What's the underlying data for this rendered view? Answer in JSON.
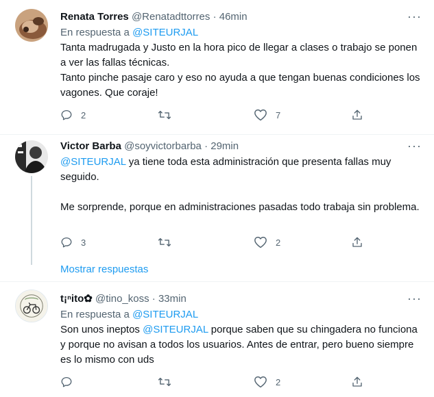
{
  "colors": {
    "accent": "#1d9bf0",
    "text": "#0f1419",
    "muted": "#536471",
    "divider": "#eff3f4"
  },
  "tweets": [
    {
      "name": "Renata Torres",
      "handle": "@Renatadttorres",
      "sep": "·",
      "time": "46min",
      "reply_prefix": "En respuesta a ",
      "reply_mention": "@SITEURJAL",
      "text_lines": [
        "Tanta madrugada y Justo en la hora pico de llegar a clases o trabajo se ponen a ver las fallas técnicas.",
        "Tanto pinche pasaje caro y eso no ayuda a que tengan buenas condiciones los vagones. Que coraje!"
      ],
      "counts": {
        "reply": "2",
        "retweet": "",
        "like": "7"
      },
      "icons": [
        "reply-icon",
        "retweet-icon",
        "like-icon",
        "share-icon",
        "more-icon"
      ]
    },
    {
      "name": "Victor Barba",
      "handle": "@soyvictorbarba",
      "sep": "·",
      "time": "29min",
      "text_mention": "@SITEURJAL",
      "text_line1_rest": " ya tiene toda esta administración que presenta fallas muy seguido.",
      "text_line2": "Me sorprende, porque en administraciones pasadas todo trabaja sin problema.",
      "counts": {
        "reply": "3",
        "retweet": "",
        "like": "2"
      },
      "show_replies": "Mostrar respuestas"
    },
    {
      "name": "t¡ⁿito✿",
      "handle": "@tino_koss",
      "sep": "·",
      "time": "33min",
      "reply_prefix": "En respuesta a ",
      "reply_mention": "@SITEURJAL",
      "text_before": "Son unos ineptos ",
      "text_mention": "@SITEURJAL",
      "text_after": " porque saben que su chingadera no funciona y porque no avisan a todos los usuarios. Antes de entrar, pero bueno siempre es lo mismo con uds",
      "counts": {
        "reply": "",
        "retweet": "",
        "like": "2"
      }
    }
  ],
  "more_glyph": "···"
}
